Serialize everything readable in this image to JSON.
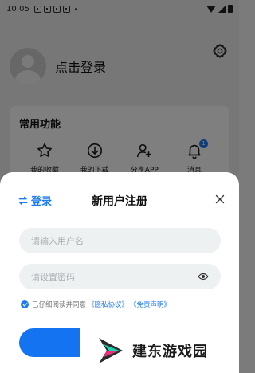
{
  "status_bar": {
    "time": "10:05"
  },
  "profile": {
    "login_prompt": "点击登录"
  },
  "features": {
    "title": "常用功能",
    "items": [
      {
        "label": "我的收藏",
        "icon": "star-icon"
      },
      {
        "label": "我的下载",
        "icon": "download-icon"
      },
      {
        "label": "分享APP",
        "icon": "share-user-icon"
      },
      {
        "label": "消息",
        "icon": "bell-icon",
        "badge": "1"
      }
    ]
  },
  "sheet": {
    "switch_label": "登录",
    "title": "新用户注册",
    "username_placeholder": "请输入用户名",
    "password_placeholder": "请设置密码",
    "agree_text": "已仔细阅读并同意",
    "privacy_link": "《隐私协议》",
    "disclaimer_link": "《免责声明》"
  },
  "watermark": {
    "text": "建东游戏园"
  },
  "colors": {
    "accent": "#1e7bf2",
    "button": "#1473f0"
  }
}
